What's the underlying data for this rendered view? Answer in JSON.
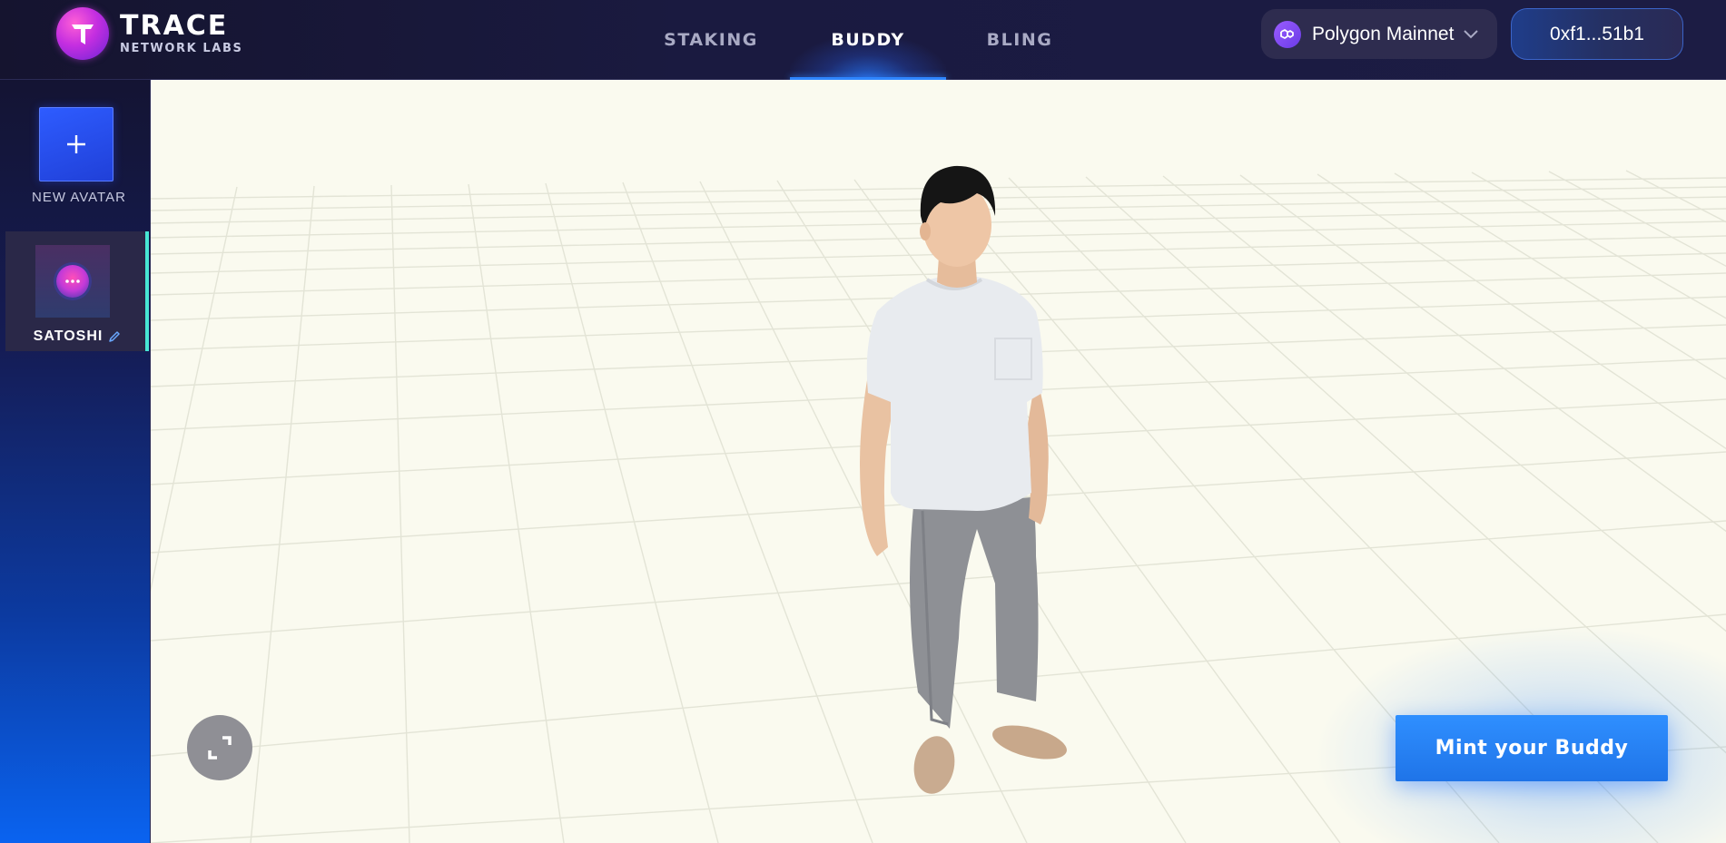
{
  "brand": {
    "title": "TRACE",
    "subtitle": "NETWORK LABS"
  },
  "nav": {
    "tabs": [
      {
        "label": "STAKING",
        "active": false
      },
      {
        "label": "BUDDY",
        "active": true
      },
      {
        "label": "BLING",
        "active": false
      }
    ]
  },
  "network": {
    "label": "Polygon Mainnet",
    "icon": "polygon-icon"
  },
  "wallet": {
    "address": "0xf1...51b1"
  },
  "sidebar": {
    "new_avatar_label": "NEW AVATAR",
    "new_avatar_icon": "plus-icon",
    "avatars": [
      {
        "name": "SATOSHI",
        "selected": true,
        "edit_icon": "pencil-icon"
      }
    ]
  },
  "viewer": {
    "fullscreen_icon": "expand-icon",
    "mint_label": "Mint your Buddy"
  },
  "colors": {
    "header_bg": "#1a1a40",
    "accent_blue": "#2f86ff",
    "selected_marker": "#47e6d4",
    "viewer_bg": "#fafaef",
    "mint_button": "#2584f5"
  }
}
